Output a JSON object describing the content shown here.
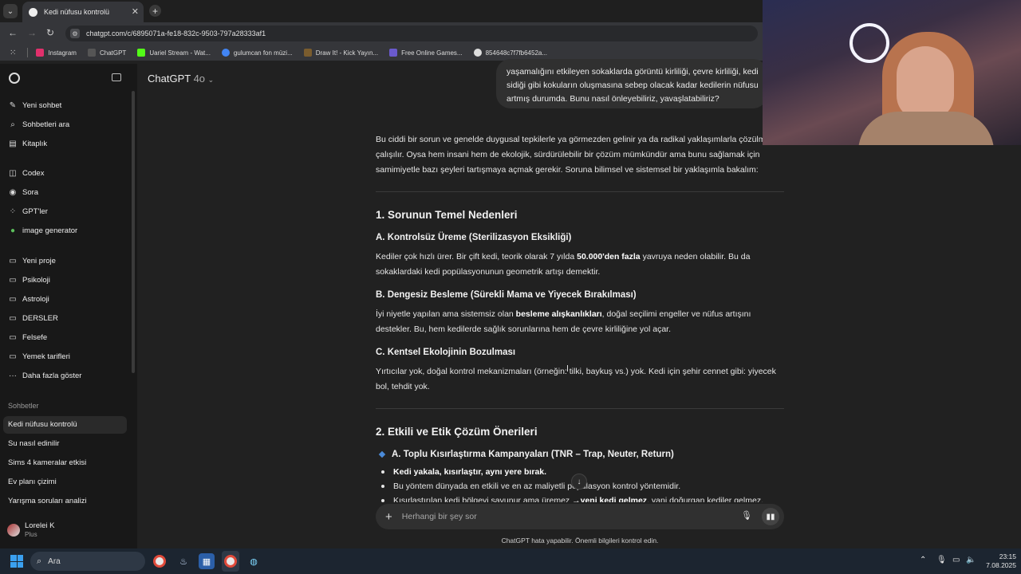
{
  "browser": {
    "tab_title": "Kedi nüfusu kontrolü",
    "tab_close": "✕",
    "new_tab": "+",
    "url": "chatgpt.com/c/6895071a-fe18-832c-9503-797a28333af1",
    "bookmarks": [
      {
        "label": "Instagram",
        "color": "#e1306c"
      },
      {
        "label": "ChatGPT",
        "color": "#333333"
      },
      {
        "label": "Uariel Stream - Wat...",
        "color": "#53fc18"
      },
      {
        "label": "gulumcan fon müzi...",
        "color": "#4285f4"
      },
      {
        "label": "Draw It! - Kick Yayın...",
        "color": "#7a5c2e"
      },
      {
        "label": "Free Online Games...",
        "color": "#6a5acd"
      },
      {
        "label": "854648c7f7fb6452a...",
        "color": "#dddddd"
      }
    ]
  },
  "sidebar": {
    "top_items": [
      {
        "label": "Yeni sohbet",
        "icon": "✎"
      },
      {
        "label": "Sohbetleri ara",
        "icon": "⌕"
      },
      {
        "label": "Kitaplık",
        "icon": "▤"
      }
    ],
    "tools": [
      {
        "label": "Codex",
        "icon": "◫"
      },
      {
        "label": "Sora",
        "icon": "◉"
      },
      {
        "label": "GPT'ler",
        "icon": "⁘"
      },
      {
        "label": "image generator",
        "icon": "●"
      }
    ],
    "projects": [
      {
        "label": "Yeni proje",
        "icon": "▭"
      },
      {
        "label": "Psikoloji",
        "icon": "▭"
      },
      {
        "label": "Astroloji",
        "icon": "▭"
      },
      {
        "label": "DERSLER",
        "icon": "▭"
      },
      {
        "label": "Felsefe",
        "icon": "▭"
      },
      {
        "label": "Yemek tarifleri",
        "icon": "▭"
      },
      {
        "label": "Daha fazla göster",
        "icon": "···"
      }
    ],
    "section_label": "Sohbetler",
    "chats": [
      "Kedi nüfusu kontrolü",
      "Su nasıl edinilir",
      "Sims 4 kameralar etkisi",
      "Ev planı çizimi",
      "Yarışma soruları analizi"
    ],
    "user": {
      "name": "Lorelei K",
      "plan": "Plus"
    }
  },
  "main": {
    "model_name": "ChatGPT",
    "model_version": "4o",
    "user_message": "yaşamalığını etkileyen sokaklarda görüntü kirliliği, çevre kirliliği, kedi sidiği gibi kokuların oluşmasına sebep olacak kadar kedilerin nüfusu artmış durumda. Bunu nasıl önleyebiliriz, yavaşlatabiliriz?",
    "intro": "Bu ciddi bir sorun ve genelde duygusal tepkilerle ya görmezden gelinir ya da radikal yaklaşımlarla çözülmeye çalışılır. Oysa hem insani hem de ekolojik, sürdürülebilir bir çözüm mümkündür ama bunu sağlamak için samimiyetle bazı şeyleri tartışmaya açmak gerekir. Soruna bilimsel ve sistemsel bir yaklaşımla bakalım:",
    "section1_title": "1. Sorunun Temel Nedenleri",
    "a_title": "A. Kontrolsüz Üreme (Sterilizasyon Eksikliği)",
    "a_text_1": "Kediler çok hızlı ürer. Bir çift kedi, teorik olarak 7 yılda ",
    "a_bold": "50.000'den fazla",
    "a_text_2": " yavruya neden olabilir. Bu da sokaklardaki kedi popülasyonunun geometrik artışı demektir.",
    "b_title": "B. Dengesiz Besleme (Sürekli Mama ve Yiyecek Bırakılması)",
    "b_text_1": "İyi niyetle yapılan ama sistemsiz olan ",
    "b_bold": "besleme alışkanlıkları",
    "b_text_2": ", doğal seçilimi engeller ve nüfus artışını destekler. Bu, hem kedilerde sağlık sorunlarına hem de çevre kirliliğine yol açar.",
    "c_title": "C. Kentsel Ekolojinin Bozulması",
    "c_text": "Yırtıcılar yok, doğal kontrol mekanizmaları (örneğin: tilki, baykuş vs.) yok. Kedi için şehir cennet gibi: yiyecek bol, tehdit yok.",
    "section2_title": "2. Etkili ve Etik Çözüm Önerileri",
    "s2a_title": "A. Toplu Kısırlaştırma Kampanyaları (TNR – Trap, Neuter, Return)",
    "s2a_b1": "Kedi yakala, kısırlaştır, aynı yere bırak.",
    "s2a_b2": "Bu yöntem dünyada en etkili ve en az maliyetli popülasyon kontrol yöntemidir.",
    "s2a_b3_1": "Kısırlaştırılan kedi bölgeyi savunur ama üremez → ",
    "s2a_b3_bold": "yeni kedi gelmez",
    "s2a_b3_2": ", yani doğurgan kediler gelmez."
  },
  "composer": {
    "placeholder": "Herhangi bir şey sor",
    "disclaimer": "ChatGPT hata yapabilir. Önemli bilgileri kontrol edin."
  },
  "taskbar": {
    "search_label": "Ara",
    "time": "23:15",
    "date": "7.08.2025"
  }
}
